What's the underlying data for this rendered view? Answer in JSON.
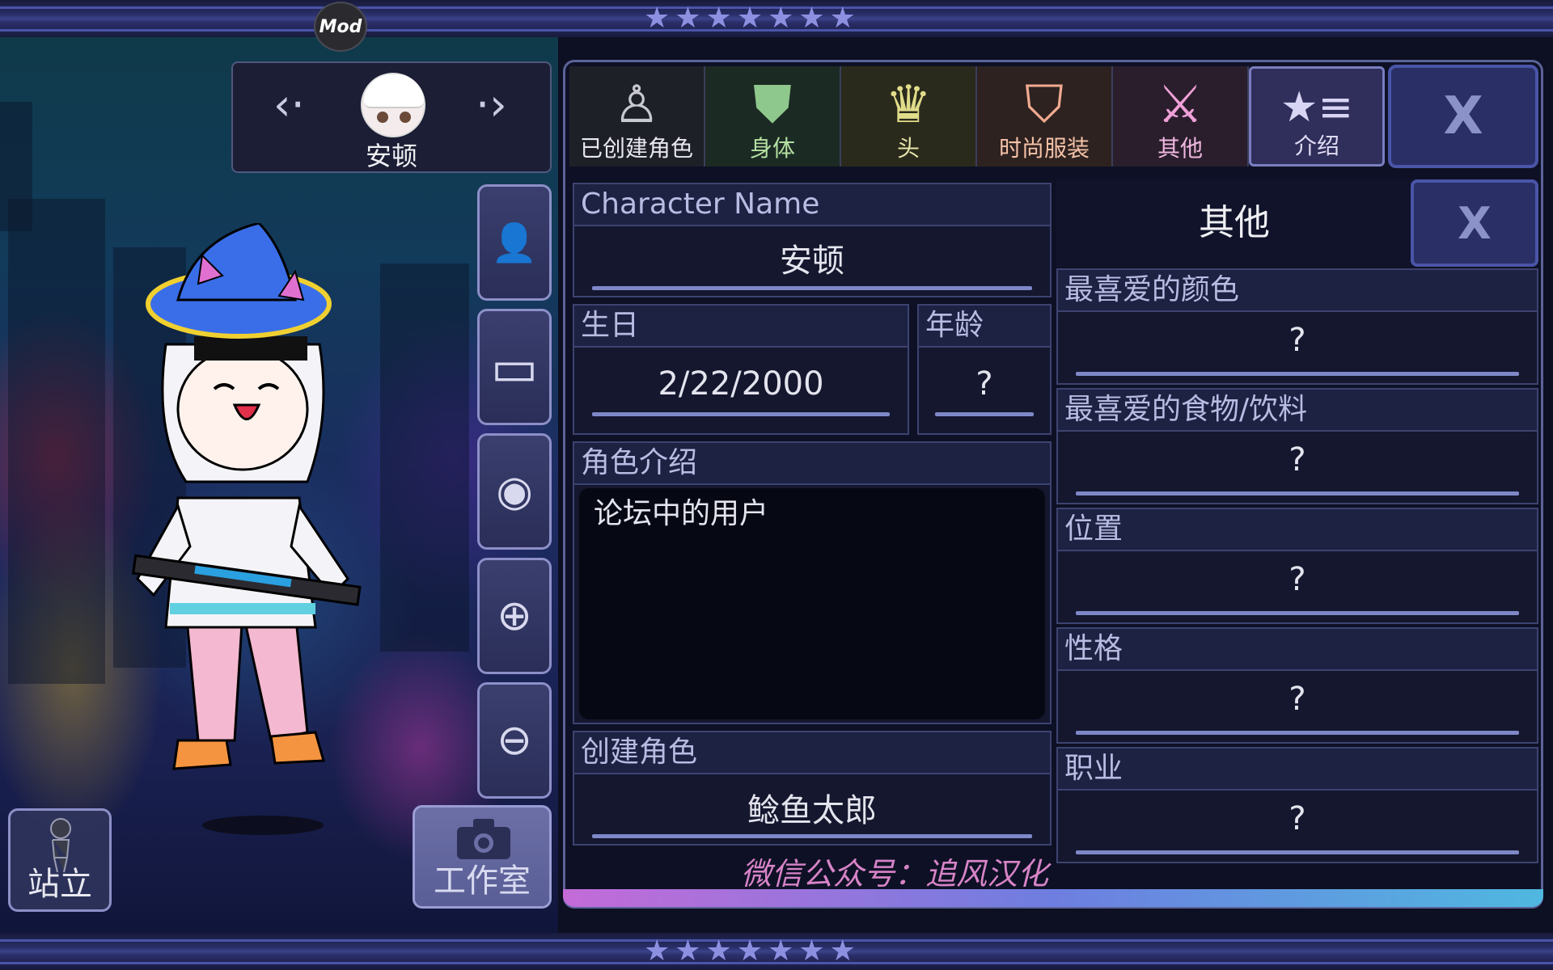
{
  "top_bar": {
    "mod_badge": "Mod",
    "stars": "★★★★★★★"
  },
  "bottom_bar": {
    "stars": "★★★★★★★"
  },
  "character": {
    "name": "安顿",
    "prev_arrow": "‹·",
    "next_arrow": "·›"
  },
  "side_buttons": [
    {
      "name": "add-character-button",
      "icon": "person-add-icon",
      "glyph": "👤"
    },
    {
      "name": "background-button",
      "icon": "image-icon",
      "glyph": "▭"
    },
    {
      "name": "visibility-button",
      "icon": "eye-icon",
      "glyph": "◉"
    },
    {
      "name": "zoom-in-button",
      "icon": "zoom-in-icon",
      "glyph": "⊕"
    },
    {
      "name": "zoom-out-button",
      "icon": "zoom-out-icon",
      "glyph": "⊖"
    }
  ],
  "stand_button": {
    "label": "站立",
    "icon": "figure-icon"
  },
  "studio_button": {
    "label": "工作室",
    "icon": "camera-icon"
  },
  "tabs": [
    {
      "label": "已创建角色",
      "icon": "figure-icon",
      "glyph": "♙"
    },
    {
      "label": "身体",
      "icon": "jacket-icon",
      "glyph": "⛊"
    },
    {
      "label": "头",
      "icon": "hair-icon",
      "glyph": "♛"
    },
    {
      "label": "时尚服装",
      "icon": "shirt-icon",
      "glyph": "⛉"
    },
    {
      "label": "其他",
      "icon": "sword-cat-icon",
      "glyph": "⚔"
    },
    {
      "label": "介绍",
      "icon": "star-list-icon",
      "glyph": "★≡"
    }
  ],
  "close_label": "X",
  "profile": {
    "character_name_label": "Character Name",
    "character_name_value": "安顿",
    "birthday_label": "生日",
    "birthday_value": "2/22/2000",
    "age_label": "年龄",
    "age_value": "?",
    "intro_label": "角色介绍",
    "intro_value": "论坛中的用户",
    "creator_label": "创建角色",
    "creator_value": "鲶鱼太郎"
  },
  "other": {
    "title": "其他",
    "fields": [
      {
        "label": "最喜爱的颜色",
        "value": "?"
      },
      {
        "label": "最喜爱的食物/饮料",
        "value": "?"
      },
      {
        "label": "位置",
        "value": "?"
      },
      {
        "label": "性格",
        "value": "?"
      },
      {
        "label": "职业",
        "value": "?"
      }
    ]
  },
  "watermark": "微信公众号：追风汉化",
  "colors": {
    "panel_bg": "#0e1125",
    "accent": "#7e88c8",
    "close_bg": "#2a2f66",
    "watermark": "#d884c8"
  }
}
